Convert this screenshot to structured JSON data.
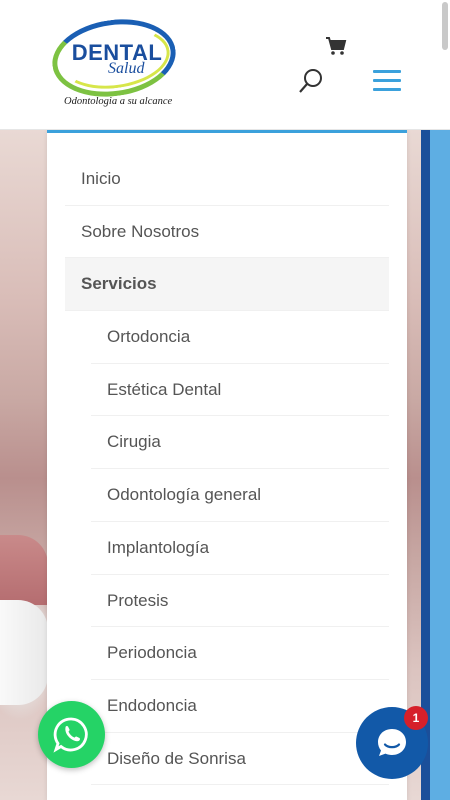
{
  "header": {
    "logo": {
      "brand": "DENTAL",
      "sub": "Salud",
      "tagline": "Odontologia a su alcance"
    },
    "icons": {
      "cart": "cart-icon",
      "search": "search-icon",
      "menu": "hamburger-menu-icon"
    }
  },
  "menu": {
    "items": [
      {
        "label": "Inicio"
      },
      {
        "label": "Sobre Nosotros"
      },
      {
        "label": "Servicios"
      }
    ],
    "sub_items": [
      {
        "label": "Ortodoncia"
      },
      {
        "label": "Estética Dental"
      },
      {
        "label": "Cirugia"
      },
      {
        "label": "Odontología general"
      },
      {
        "label": "Implantología"
      },
      {
        "label": "Protesis"
      },
      {
        "label": "Periodoncia"
      },
      {
        "label": "Endodoncia"
      },
      {
        "label": "Diseño de Sonrisa"
      }
    ]
  },
  "chat": {
    "badge_count": "1"
  },
  "colors": {
    "accent": "#3ba1dc",
    "whatsapp": "#25d366",
    "chat": "#1259a8",
    "badge": "#d6202a"
  }
}
